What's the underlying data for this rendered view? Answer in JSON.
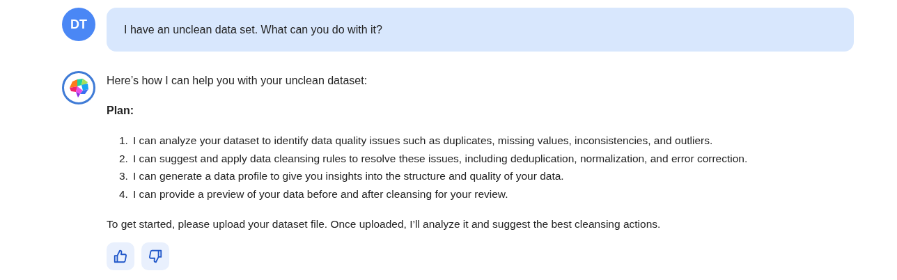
{
  "messages": [
    {
      "kind": "user",
      "avatar": "DT",
      "text": "I have an unclean data set. What can you do with it?"
    },
    {
      "kind": "assistant",
      "intro": "Here’s how I can help you with your unclean dataset:",
      "heading": "Plan:",
      "steps": [
        {
          "marker": "1.",
          "text": "I can analyze your dataset to identify data quality issues such as duplicates, missing values, inconsistencies, and outliers."
        },
        {
          "marker": "2.",
          "text": "I can suggest and apply data cleansing rules to resolve these issues, including deduplication, normalization, and error correction."
        },
        {
          "marker": "3.",
          "text": "I can generate a data profile to give you insights into the structure and quality of your data."
        },
        {
          "marker": "4.",
          "text": "I can provide a preview of your data before and after cleansing for your review."
        }
      ],
      "closing": "To get started, please upload your dataset file. Once uploaded, I’ll analyze it and suggest the best cleansing actions."
    }
  ]
}
